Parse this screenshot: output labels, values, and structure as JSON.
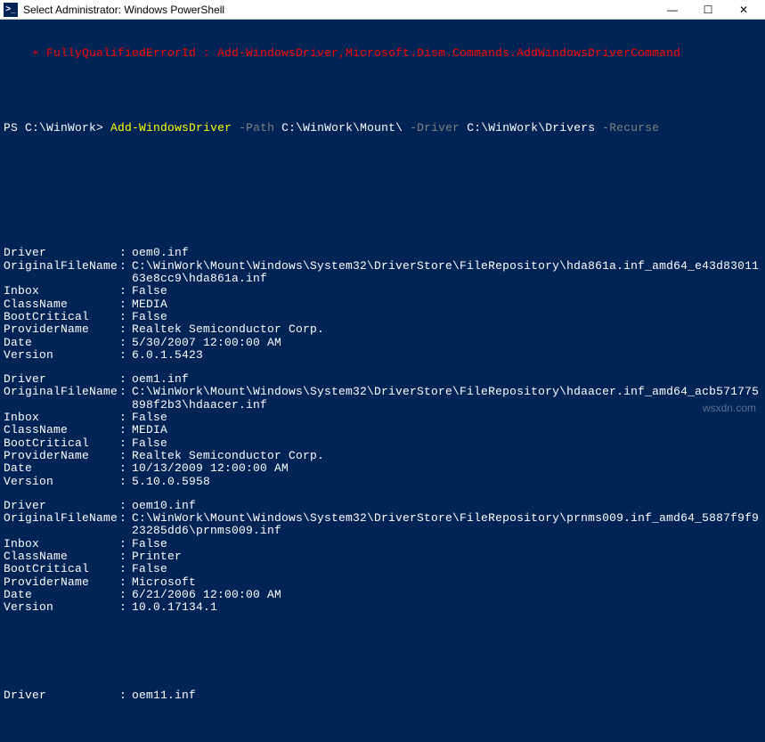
{
  "window": {
    "title": "Select Administrator: Windows PowerShell",
    "icon_glyph": ">_",
    "minimize": "—",
    "maximize": "☐",
    "close": "✕"
  },
  "error_line": "    + FullyQualifiedErrorId : Add-WindowsDriver,Microsoft.Dism.Commands.AddWindowsDriverCommand",
  "prompt": {
    "path": "PS C:\\WinWork>",
    "cmdlet": "Add-WindowsDriver",
    "p1_flag": "-Path",
    "p1_val": "C:\\WinWork\\Mount\\",
    "p2_flag": "-Driver",
    "p2_val": "C:\\WinWork\\Drivers",
    "p3_flag": "-Recurse"
  },
  "fields": [
    "Driver",
    "OriginalFileName",
    "Inbox",
    "ClassName",
    "BootCritical",
    "ProviderName",
    "Date",
    "Version"
  ],
  "drivers": [
    {
      "Driver": "oem0.inf",
      "OriginalFileName": "C:\\WinWork\\Mount\\Windows\\System32\\DriverStore\\FileRepository\\hda861a.inf_amd64_e43d8301163e8cc9\\hda861a.inf",
      "Inbox": "False",
      "ClassName": "MEDIA",
      "BootCritical": "False",
      "ProviderName": "Realtek Semiconductor Corp.",
      "Date": "5/30/2007 12:00:00 AM",
      "Version": "6.0.1.5423"
    },
    {
      "Driver": "oem1.inf",
      "OriginalFileName": "C:\\WinWork\\Mount\\Windows\\System32\\DriverStore\\FileRepository\\hdaacer.inf_amd64_acb571775898f2b3\\hdaacer.inf",
      "Inbox": "False",
      "ClassName": "MEDIA",
      "BootCritical": "False",
      "ProviderName": "Realtek Semiconductor Corp.",
      "Date": "10/13/2009 12:00:00 AM",
      "Version": "5.10.0.5958"
    },
    {
      "Driver": "oem10.inf",
      "OriginalFileName": "C:\\WinWork\\Mount\\Windows\\System32\\DriverStore\\FileRepository\\prnms009.inf_amd64_5887f9f923285dd6\\prnms009.inf",
      "Inbox": "False",
      "ClassName": "Printer",
      "BootCritical": "False",
      "ProviderName": "Microsoft",
      "Date": "6/21/2006 12:00:00 AM",
      "Version": "10.0.17134.1"
    }
  ],
  "trailing": {
    "Driver": "oem11.inf"
  },
  "watermark": "wsxdn.com"
}
